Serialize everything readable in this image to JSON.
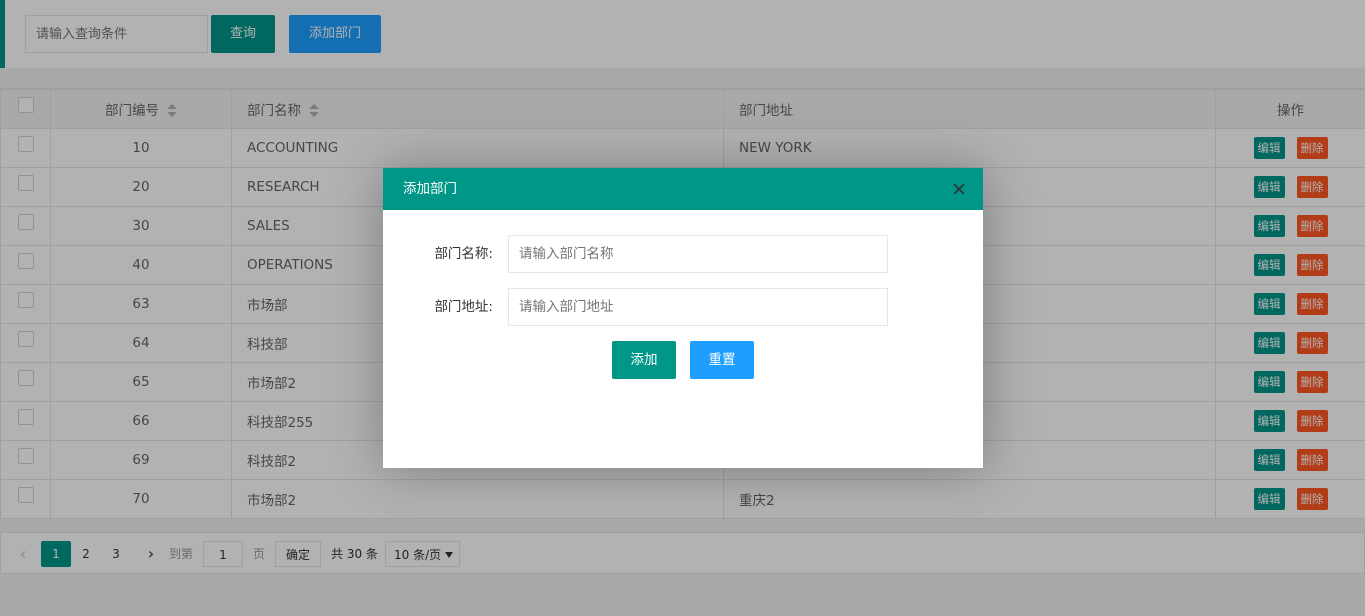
{
  "toolbar": {
    "search_placeholder": "请输入查询条件",
    "search_label": "查询",
    "add_label": "添加部门"
  },
  "table": {
    "headers": {
      "id": "部门编号",
      "name": "部门名称",
      "address": "部门地址",
      "actions": "操作"
    },
    "edit_label": "编辑",
    "delete_label": "删除",
    "rows": [
      {
        "id": "10",
        "name": "ACCOUNTING",
        "address": "NEW YORK"
      },
      {
        "id": "20",
        "name": "RESEARCH",
        "address": ""
      },
      {
        "id": "30",
        "name": "SALES",
        "address": ""
      },
      {
        "id": "40",
        "name": "OPERATIONS",
        "address": ""
      },
      {
        "id": "63",
        "name": "市场部",
        "address": ""
      },
      {
        "id": "64",
        "name": "科技部",
        "address": ""
      },
      {
        "id": "65",
        "name": "市场部2",
        "address": ""
      },
      {
        "id": "66",
        "name": "科技部255",
        "address": ""
      },
      {
        "id": "69",
        "name": "科技部2",
        "address": ""
      },
      {
        "id": "70",
        "name": "市场部2",
        "address": "重庆2"
      }
    ]
  },
  "pager": {
    "pages": [
      "1",
      "2",
      "3"
    ],
    "current": "1",
    "goto_label": "到第",
    "goto_value": "1",
    "page_label": "页",
    "confirm_label": "确定",
    "total_label": "共 30 条",
    "page_size": "10 条/页"
  },
  "dialog": {
    "title": "添加部门",
    "name_label": "部门名称:",
    "name_placeholder": "请输入部门名称",
    "address_label": "部门地址:",
    "address_placeholder": "请输入部门地址",
    "add_label": "添加",
    "reset_label": "重置"
  },
  "colors": {
    "primary": "#009688",
    "blue": "#1E9FFF",
    "danger": "#FF5722"
  }
}
